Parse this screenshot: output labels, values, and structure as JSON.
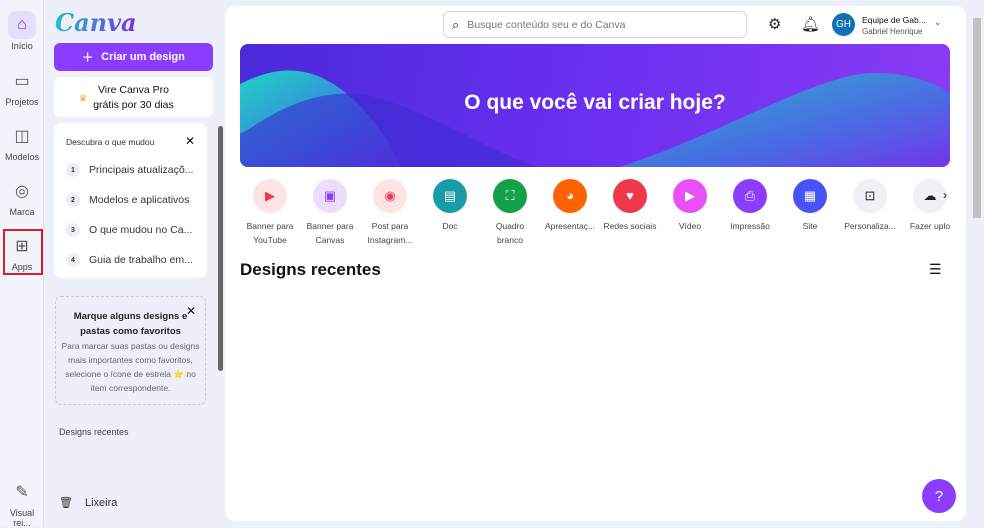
{
  "rail": [
    {
      "label": "Início",
      "icon": "home-icon"
    },
    {
      "label": "Projetos",
      "icon": "folder-icon"
    },
    {
      "label": "Modelos",
      "icon": "template-icon"
    },
    {
      "label": "Marca",
      "icon": "brand-icon"
    },
    {
      "label": "Apps",
      "icon": "apps-icon"
    },
    {
      "label": "Visual rei...",
      "icon": "feedback-icon"
    }
  ],
  "sidebar": {
    "logo": "Canva",
    "create": "Criar um design",
    "pro_line1": "Vire Canva Pro",
    "pro_line2": "grátis por 30 dias",
    "whatsnew": {
      "title": "Descubra o que mudou",
      "items": [
        "Principais atualizaçõ...",
        "Modelos e aplicativos",
        "O que mudou no Ca...",
        "Guia de trabalho em..."
      ]
    },
    "fav": {
      "title": "Marque alguns designs e pastas como favoritos",
      "desc": "Para marcar suas pastas ou designs mais importantes como favoritos, selecione o ícone de estrela ⭐ no item correspondente."
    },
    "recent": "Designs recentes",
    "trash": "Lixeira"
  },
  "header": {
    "search_placeholder": "Busque conteúdo seu e do Canva",
    "avatar": "GH",
    "team": "Equipe de Gab...",
    "user": "Gabriel Henrique"
  },
  "banner": {
    "title": "O que você vai criar hoje?"
  },
  "types": [
    {
      "l1": "Banner para",
      "l2": "YouTube",
      "color": "#fde3e5",
      "fg": "#f0384c"
    },
    {
      "l1": "Banner para",
      "l2": "Canvas",
      "color": "#ecdcfd",
      "fg": "#8b3dff"
    },
    {
      "l1": "Post para",
      "l2": "Instagram...",
      "color": "#fde3e5",
      "fg": "#f0384c"
    },
    {
      "l1": "Doc",
      "l2": "",
      "color": "#1a9ca8",
      "fg": "#fff"
    },
    {
      "l1": "Quadro",
      "l2": "branco",
      "color": "#13a14a",
      "fg": "#fff"
    },
    {
      "l1": "Apresentaç...",
      "l2": "",
      "color": "#ff6105",
      "fg": "#fff"
    },
    {
      "l1": "Redes sociais",
      "l2": "",
      "color": "#f0384c",
      "fg": "#fff"
    },
    {
      "l1": "Vídeo",
      "l2": "",
      "color": "#e950f7",
      "fg": "#fff"
    },
    {
      "l1": "Impressão",
      "l2": "",
      "color": "#8b3dff",
      "fg": "#fff"
    },
    {
      "l1": "Site",
      "l2": "",
      "color": "#4a53fa",
      "fg": "#fff"
    },
    {
      "l1": "Personaliza...",
      "l2": "",
      "color": "#f0f1f5",
      "fg": "#222"
    },
    {
      "l1": "Fazer uplo",
      "l2": "",
      "color": "#f0f1f5",
      "fg": "#222"
    }
  ],
  "recent_title": "Designs recentes",
  "help": "?"
}
